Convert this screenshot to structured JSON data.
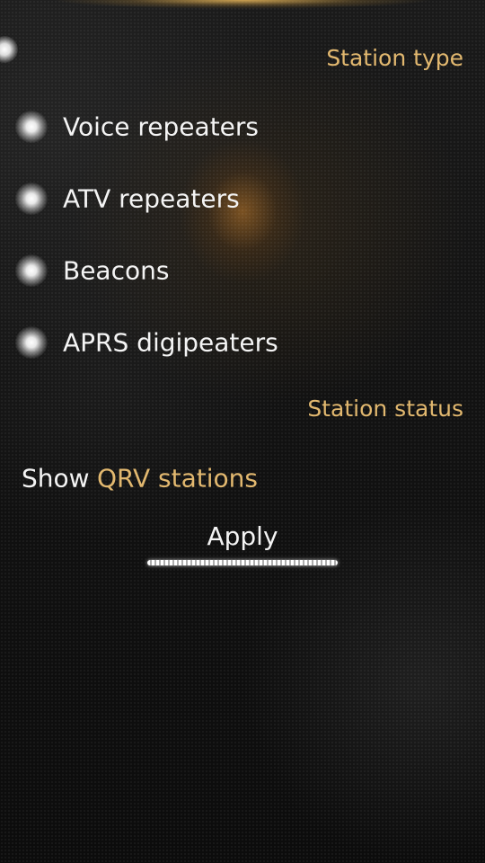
{
  "sections": {
    "station_type": "Station type",
    "station_status": "Station status"
  },
  "station_types": [
    {
      "label": "Voice repeaters",
      "checked": true
    },
    {
      "label": "ATV repeaters",
      "checked": true
    },
    {
      "label": "Beacons",
      "checked": true
    },
    {
      "label": "APRS digipeaters",
      "checked": true
    }
  ],
  "status": {
    "label": "Show",
    "value": "QRV stations"
  },
  "apply_label": "Apply",
  "colors": {
    "accent": "#e2b86f",
    "text": "#f4f4f4",
    "background": "#0b0b0b"
  },
  "icons": {
    "pulley_menu": "pulley-menu-indicator-icon",
    "switch_on": "glowing-switch-indicator-icon"
  }
}
